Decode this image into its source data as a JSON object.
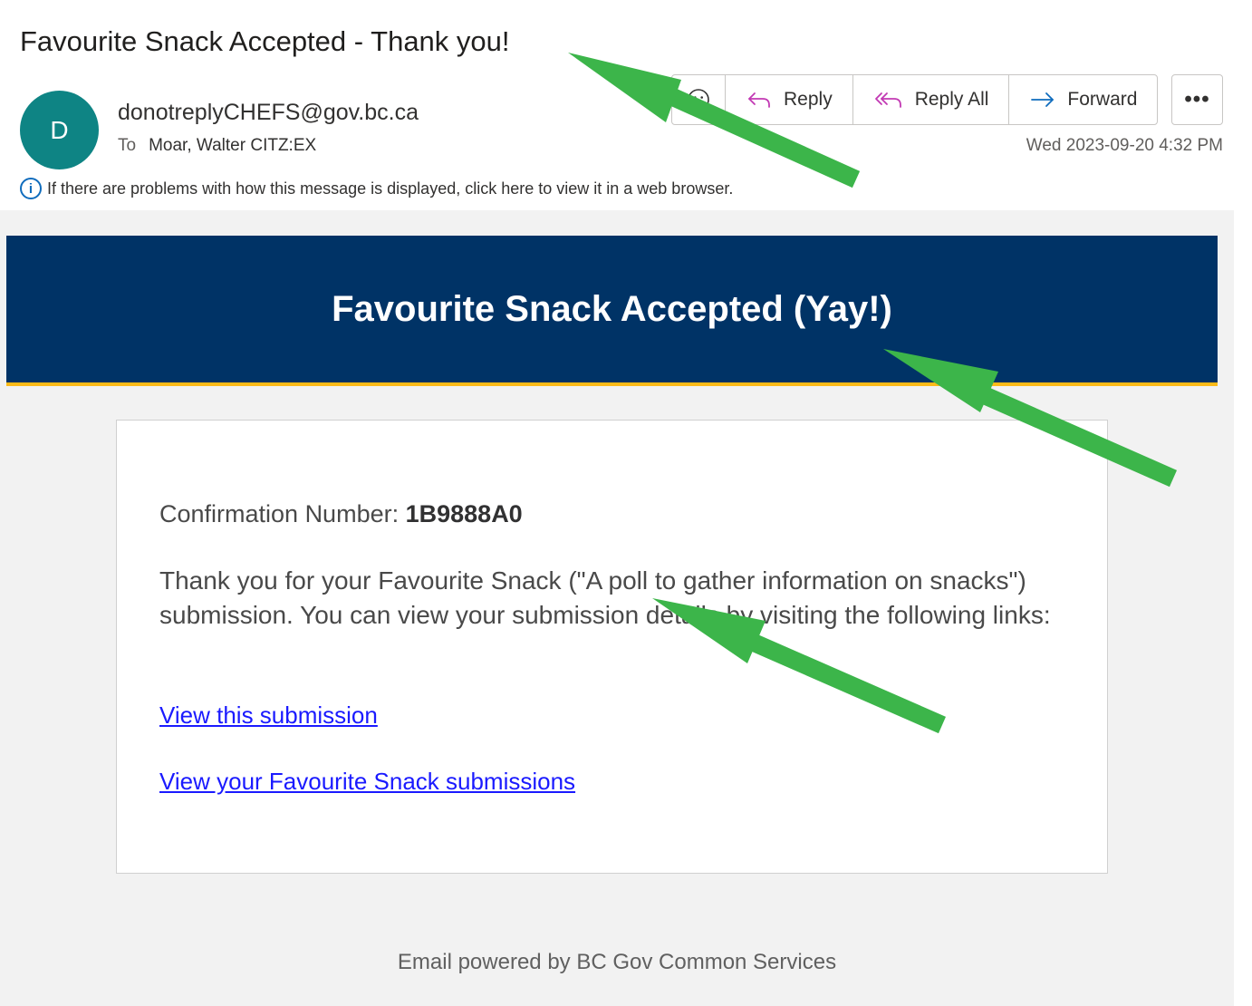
{
  "header": {
    "subject": "Favourite Snack Accepted - Thank you!",
    "avatar_letter": "D",
    "sender": "donotreplyCHEFS@gov.bc.ca",
    "to_label": "To",
    "recipient": "Moar, Walter CITZ:EX",
    "date": "Wed 2023-09-20 4:32 PM",
    "actions": {
      "reply": "Reply",
      "reply_all": "Reply All",
      "forward": "Forward",
      "more": "•••"
    },
    "info_text": "If there are problems with how this message is displayed, click here to view it in a web browser.",
    "avatar_color": "#0e8484",
    "reply_icon_color": "#c239b3",
    "forward_icon_color": "#0f6cbd"
  },
  "email": {
    "banner_title": "Favourite Snack Accepted (Yay!)",
    "banner_color": "#003366",
    "accent_color": "#fcba19",
    "confirmation_label": "Confirmation Number:",
    "confirmation_number": "1B9888A0",
    "message": "Thank you for your Favourite Snack (\"A poll to gather information on snacks\") submission. You can view your submission details by visiting the following links:",
    "link_view_submission": "View this submission",
    "link_view_all": "View your Favourite Snack submissions",
    "footer": "Email powered by BC Gov Common Services"
  },
  "annotations": {
    "arrow_color": "#3cb54a"
  }
}
